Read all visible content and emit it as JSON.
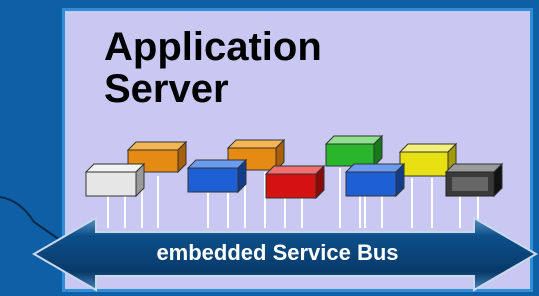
{
  "title": {
    "line1": "Application",
    "line2": "Server"
  },
  "bus": {
    "label": "embedded Service Bus"
  },
  "colors": {
    "background": "#0e5fa6",
    "panel": "#c9c8f2",
    "bus": "#0b4f86",
    "services": [
      "#d8d8d8",
      "#e58a12",
      "#1f5fd6",
      "#e58a12",
      "#d41212",
      "#29b52c",
      "#1f5fd6",
      "#e8e012",
      "#3a3a3a"
    ]
  },
  "services": [
    {
      "name": "service-gray",
      "color": "#d8d8d8"
    },
    {
      "name": "service-orange-1",
      "color": "#e58a12"
    },
    {
      "name": "service-blue-1",
      "color": "#1f5fd6"
    },
    {
      "name": "service-orange-2",
      "color": "#e58a12"
    },
    {
      "name": "service-red",
      "color": "#d41212"
    },
    {
      "name": "service-green",
      "color": "#29b52c"
    },
    {
      "name": "service-blue-2",
      "color": "#1f5fd6"
    },
    {
      "name": "service-yellow",
      "color": "#e8e012"
    },
    {
      "name": "service-black",
      "color": "#3a3a3a"
    }
  ]
}
